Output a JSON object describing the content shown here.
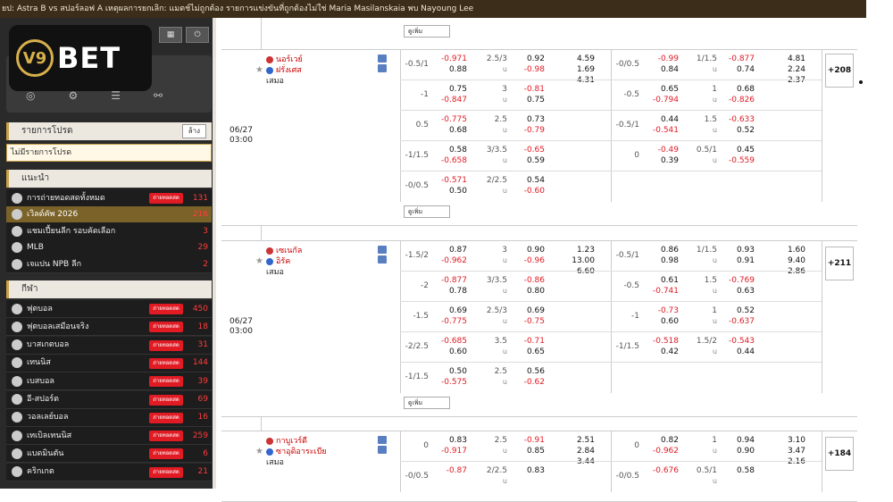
{
  "ticker": "ยป: Astra B vs สปอร์ลอฟ A เหตุผลการยกเลิก: แมตช์ไม่ถูกต้อง รายการแข่งขันที่ถูกต้องไม่ใช่ Maria Masilanskaia พบ Nayoung Lee",
  "logo": {
    "mark": "V9",
    "text": "BET"
  },
  "user": {
    "score": "0"
  },
  "sidebar": {
    "fav_title": "รายการโปรด",
    "edit": "ล้าง",
    "fav_empty": "ไม่มีรายการโปรด",
    "rec_title": "แนะนำ",
    "rec": [
      {
        "label": "การถ่ายทอดสดทั้งหมด",
        "live": "ถ่ายทอดสด",
        "count": "131"
      },
      {
        "label": "เวิลด์คัพ 2026",
        "live": "",
        "count": "216"
      },
      {
        "label": "แชมเปี้ยนลีก รอบคัดเลือก",
        "live": "",
        "count": "3"
      },
      {
        "label": "MLB",
        "live": "",
        "count": "29"
      },
      {
        "label": "เจแปน NPB ลีก",
        "live": "",
        "count": "2"
      }
    ],
    "sport_title": "กีฬา",
    "sports": [
      {
        "label": "ฟุตบอล",
        "live": "ถ่ายทอดสด",
        "count": "450"
      },
      {
        "label": "ฟุตบอลเสมือนจริง",
        "live": "ถ่ายทอดสด",
        "count": "18"
      },
      {
        "label": "บาสเกตบอล",
        "live": "ถ่ายทอดสด",
        "count": "31"
      },
      {
        "label": "เทนนิส",
        "live": "ถ่ายทอดสด",
        "count": "144"
      },
      {
        "label": "เบสบอล",
        "live": "ถ่ายทอดสด",
        "count": "39"
      },
      {
        "label": "อี-สปอร์ต",
        "live": "ถ่ายทอดสด",
        "count": "69"
      },
      {
        "label": "วอลเลย์บอล",
        "live": "ถ่ายทอดสด",
        "count": "16"
      },
      {
        "label": "เทเบิลเทนนิส",
        "live": "ถ่ายทอดสด",
        "count": "259"
      },
      {
        "label": "แบดมินตัน",
        "live": "ถ่ายทอดสด",
        "count": "6"
      },
      {
        "label": "คริกเกต",
        "live": "ถ่ายทอดสด",
        "count": "21"
      }
    ]
  },
  "expand_label": "ดูเพิ่ม",
  "matches": [
    {
      "date": "06/27",
      "time": "03:00",
      "home": "นอร์เวย์",
      "away": "ฝรั่งเศส",
      "draw": "เสมอ",
      "more": "+208",
      "rows": [
        {
          "h1": "-0.5/1",
          "a1": "-0.971",
          "b1": "0.88",
          "ou1": "2.5/3",
          "c1": "0.92",
          "d1": "-0.98",
          "x12": [
            "4.59",
            "1.69",
            "4.31"
          ],
          "h2": "-0/0.5",
          "a2": "-0.99",
          "b2": "0.84",
          "ou2": "1/1.5",
          "c2": "-0.877",
          "d2": "0.74",
          "x2": [
            "4.81",
            "2.24",
            "2.37"
          ]
        },
        {
          "h1": "-1",
          "a1": "0.75",
          "b1": "-0.847",
          "ou1": "3",
          "c1": "-0.81",
          "d1": "0.75",
          "h2": "-0.5",
          "a2": "0.65",
          "b2": "-0.794",
          "ou2": "1",
          "c2": "0.68",
          "d2": "-0.826"
        },
        {
          "h1": "0.5",
          "a1": "-0.775",
          "b1": "0.68",
          "ou1": "2.5",
          "c1": "0.73",
          "d1": "-0.79",
          "h2": "-0.5/1",
          "a2": "0.44",
          "b2": "-0.541",
          "ou2": "1.5",
          "c2": "-0.633",
          "d2": "0.52"
        },
        {
          "h1": "-1/1.5",
          "a1": "0.58",
          "b1": "-0.658",
          "ou1": "3/3.5",
          "c1": "-0.65",
          "d1": "0.59",
          "h2": "0",
          "a2": "-0.49",
          "b2": "0.39",
          "ou2": "0.5/1",
          "c2": "0.45",
          "d2": "-0.559"
        },
        {
          "h1": "-0/0.5",
          "a1": "-0.571",
          "b1": "0.50",
          "ou1": "2/2.5",
          "c1": "0.54",
          "d1": "-0.60"
        }
      ]
    },
    {
      "date": "06/27",
      "time": "03:00",
      "home": "เซเนกัล",
      "away": "อิรัค",
      "draw": "เสมอ",
      "more": "+211",
      "rows": [
        {
          "h1": "-1.5/2",
          "a1": "0.87",
          "b1": "-0.962",
          "ou1": "3",
          "c1": "0.90",
          "d1": "-0.96",
          "x12": [
            "1.23",
            "13.00",
            "6.60"
          ],
          "h2": "-0.5/1",
          "a2": "0.86",
          "b2": "0.98",
          "ou2": "1/1.5",
          "c2": "0.93",
          "d2": "0.91",
          "x2": [
            "1.60",
            "9.40",
            "2.86"
          ]
        },
        {
          "h1": "-2",
          "a1": "-0.877",
          "b1": "0.78",
          "ou1": "3/3.5",
          "c1": "-0.86",
          "d1": "0.80",
          "h2": "-0.5",
          "a2": "0.61",
          "b2": "-0.741",
          "ou2": "1.5",
          "c2": "-0.769",
          "d2": "0.63"
        },
        {
          "h1": "-1.5",
          "a1": "0.69",
          "b1": "-0.775",
          "ou1": "2.5/3",
          "c1": "0.69",
          "d1": "-0.75",
          "h2": "-1",
          "a2": "-0.73",
          "b2": "0.60",
          "ou2": "1",
          "c2": "0.52",
          "d2": "-0.637"
        },
        {
          "h1": "-2/2.5",
          "a1": "-0.685",
          "b1": "0.60",
          "ou1": "3.5",
          "c1": "-0.71",
          "d1": "0.65",
          "h2": "-1/1.5",
          "a2": "-0.518",
          "b2": "0.42",
          "ou2": "1.5/2",
          "c2": "-0.543",
          "d2": "0.44"
        },
        {
          "h1": "-1/1.5",
          "a1": "0.50",
          "b1": "-0.575",
          "ou1": "2.5",
          "c1": "0.56",
          "d1": "-0.62"
        }
      ]
    },
    {
      "date": "",
      "time": "",
      "home": "กาบูเวร์ดี",
      "away": "ซาอุดิอาระเบีย",
      "draw": "เสมอ",
      "more": "+184",
      "rows": [
        {
          "h1": "0",
          "a1": "0.83",
          "b1": "-0.917",
          "ou1": "2.5",
          "c1": "-0.91",
          "d1": "0.85",
          "x12": [
            "2.51",
            "2.84",
            "3.44"
          ],
          "h2": "0",
          "a2": "0.82",
          "b2": "-0.962",
          "ou2": "1",
          "c2": "0.94",
          "d2": "0.90",
          "x2": [
            "3.10",
            "3.47",
            "2.16"
          ]
        },
        {
          "h1": "-0/0.5",
          "a1": "-0.87",
          "b1": "",
          "ou1": "2/2.5",
          "c1": "0.83",
          "d1": "",
          "h2": "-0/0.5",
          "a2": "-0.676",
          "b2": "",
          "ou2": "0.5/1",
          "c2": "0.58",
          "d2": ""
        }
      ]
    }
  ],
  "colors": {
    "accent": "#c9a24a",
    "live": "#e01b24",
    "negative": "#e01b24"
  }
}
